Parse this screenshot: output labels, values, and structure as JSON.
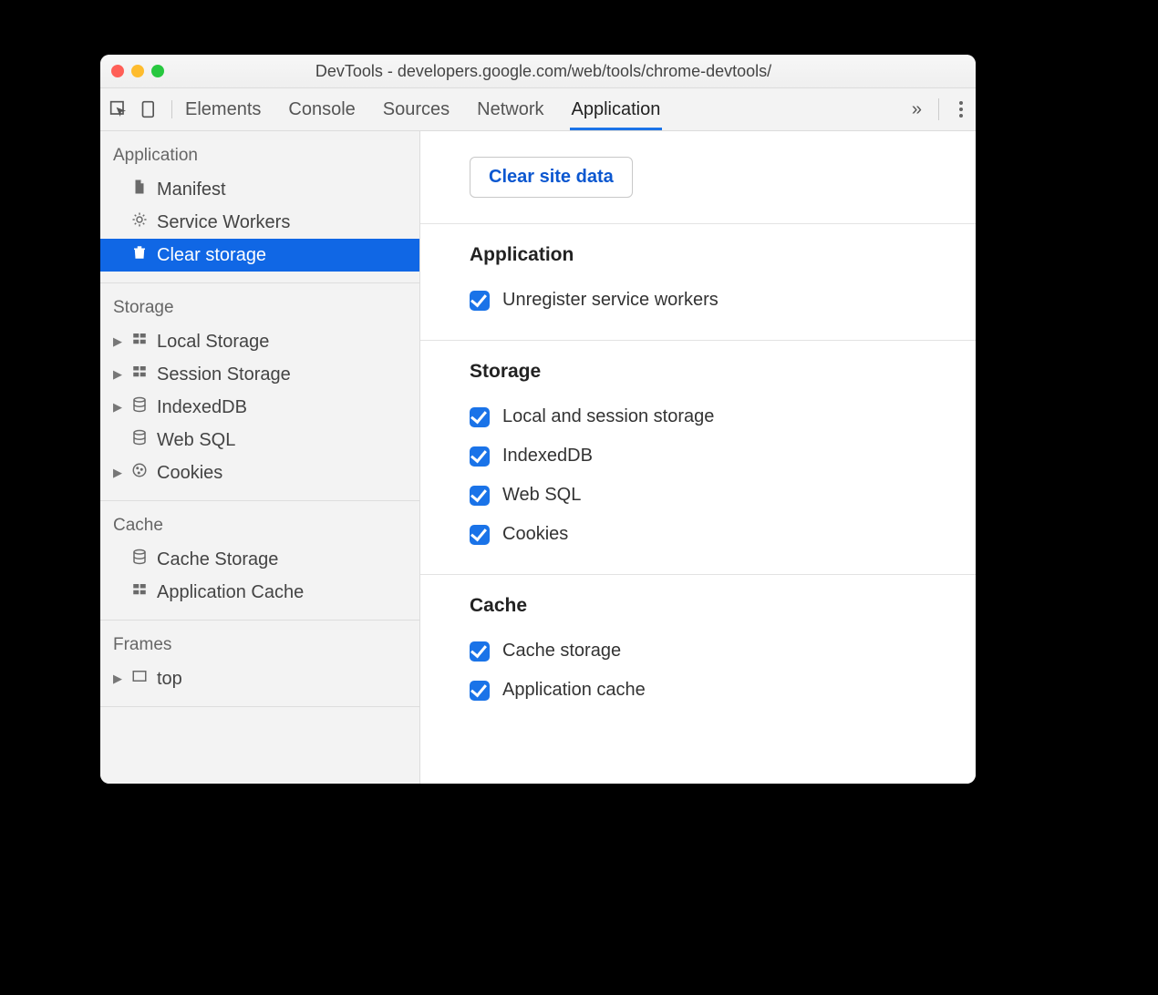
{
  "window": {
    "title": "DevTools - developers.google.com/web/tools/chrome-devtools/"
  },
  "toolbar": {
    "tabs": [
      "Elements",
      "Console",
      "Sources",
      "Network",
      "Application"
    ],
    "active_tab": "Application"
  },
  "sidebar": {
    "groups": [
      {
        "title": "Application",
        "items": [
          {
            "label": "Manifest",
            "icon": "file",
            "expandable": false,
            "selected": false
          },
          {
            "label": "Service Workers",
            "icon": "gear",
            "expandable": false,
            "selected": false
          },
          {
            "label": "Clear storage",
            "icon": "trash",
            "expandable": false,
            "selected": true
          }
        ]
      },
      {
        "title": "Storage",
        "items": [
          {
            "label": "Local Storage",
            "icon": "grid",
            "expandable": true,
            "selected": false
          },
          {
            "label": "Session Storage",
            "icon": "grid",
            "expandable": true,
            "selected": false
          },
          {
            "label": "IndexedDB",
            "icon": "db",
            "expandable": true,
            "selected": false
          },
          {
            "label": "Web SQL",
            "icon": "db",
            "expandable": false,
            "selected": false
          },
          {
            "label": "Cookies",
            "icon": "cookie",
            "expandable": true,
            "selected": false
          }
        ]
      },
      {
        "title": "Cache",
        "items": [
          {
            "label": "Cache Storage",
            "icon": "db",
            "expandable": false,
            "selected": false
          },
          {
            "label": "Application Cache",
            "icon": "grid",
            "expandable": false,
            "selected": false
          }
        ]
      },
      {
        "title": "Frames",
        "items": [
          {
            "label": "top",
            "icon": "frame",
            "expandable": true,
            "selected": false
          }
        ]
      }
    ]
  },
  "main": {
    "clear_button": "Clear site data",
    "sections": [
      {
        "heading": "Application",
        "checks": [
          {
            "label": "Unregister service workers",
            "checked": true
          }
        ]
      },
      {
        "heading": "Storage",
        "checks": [
          {
            "label": "Local and session storage",
            "checked": true
          },
          {
            "label": "IndexedDB",
            "checked": true
          },
          {
            "label": "Web SQL",
            "checked": true
          },
          {
            "label": "Cookies",
            "checked": true
          }
        ]
      },
      {
        "heading": "Cache",
        "checks": [
          {
            "label": "Cache storage",
            "checked": true
          },
          {
            "label": "Application cache",
            "checked": true
          }
        ]
      }
    ]
  }
}
